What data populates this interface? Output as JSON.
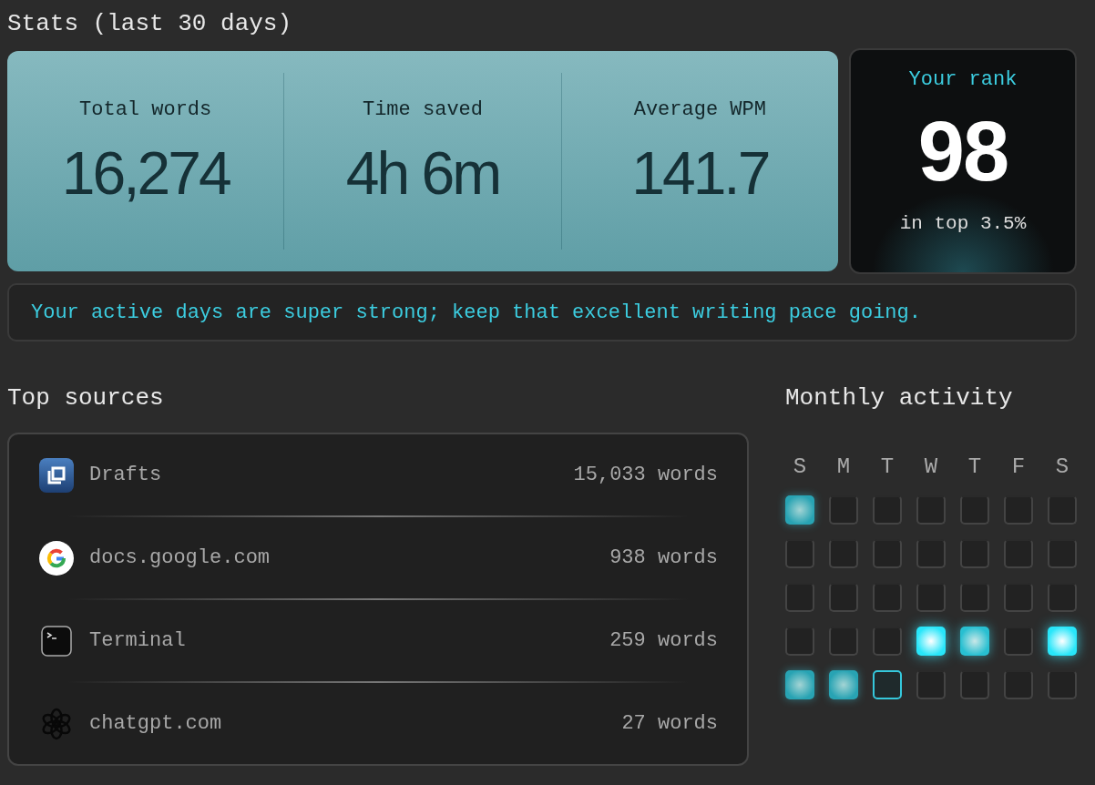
{
  "title": "Stats (last 30 days)",
  "stats": [
    {
      "label": "Total words",
      "value": "16,274"
    },
    {
      "label": "Time saved",
      "value": "4h 6m"
    },
    {
      "label": "Average WPM",
      "value": "141.7"
    }
  ],
  "rank": {
    "label": "Your rank",
    "value": "98",
    "caption": "in top 3.5%"
  },
  "tip": "Your active days are super strong; keep that excellent writing pace going.",
  "sources": {
    "title": "Top sources",
    "items": [
      {
        "kind": "drafts",
        "name": "Drafts",
        "count": "15,033 words"
      },
      {
        "kind": "google",
        "name": "docs.google.com",
        "count": "938 words"
      },
      {
        "kind": "terminal",
        "name": "Terminal",
        "count": "259 words"
      },
      {
        "kind": "chatgpt",
        "name": "chatgpt.com",
        "count": "27 words"
      }
    ]
  },
  "activity": {
    "title": "Monthly activity",
    "weekdays": [
      "S",
      "M",
      "T",
      "W",
      "T",
      "F",
      "S"
    ],
    "weeks": [
      [
        {
          "kind": "low",
          "today": false
        },
        {
          "kind": "empty",
          "today": false
        },
        {
          "kind": "empty",
          "today": false
        },
        {
          "kind": "empty",
          "today": false
        },
        {
          "kind": "empty",
          "today": false
        },
        {
          "kind": "empty",
          "today": false
        },
        {
          "kind": "empty",
          "today": false
        }
      ],
      [
        {
          "kind": "empty",
          "today": false
        },
        {
          "kind": "empty",
          "today": false
        },
        {
          "kind": "empty",
          "today": false
        },
        {
          "kind": "empty",
          "today": false
        },
        {
          "kind": "empty",
          "today": false
        },
        {
          "kind": "empty",
          "today": false
        },
        {
          "kind": "empty",
          "today": false
        }
      ],
      [
        {
          "kind": "empty",
          "today": false
        },
        {
          "kind": "empty",
          "today": false
        },
        {
          "kind": "empty",
          "today": false
        },
        {
          "kind": "empty",
          "today": false
        },
        {
          "kind": "empty",
          "today": false
        },
        {
          "kind": "empty",
          "today": false
        },
        {
          "kind": "empty",
          "today": false
        }
      ],
      [
        {
          "kind": "empty",
          "today": false
        },
        {
          "kind": "empty",
          "today": false
        },
        {
          "kind": "empty",
          "today": false
        },
        {
          "kind": "high",
          "today": false
        },
        {
          "kind": "medium",
          "today": false
        },
        {
          "kind": "empty",
          "today": false
        },
        {
          "kind": "high",
          "today": false
        }
      ],
      [
        {
          "kind": "low",
          "today": false
        },
        {
          "kind": "low",
          "today": false
        },
        {
          "kind": "empty",
          "today": true
        },
        {
          "kind": "empty",
          "today": false
        },
        {
          "kind": "empty",
          "today": false
        },
        {
          "kind": "empty",
          "today": false
        },
        {
          "kind": "empty",
          "today": false
        }
      ]
    ]
  }
}
